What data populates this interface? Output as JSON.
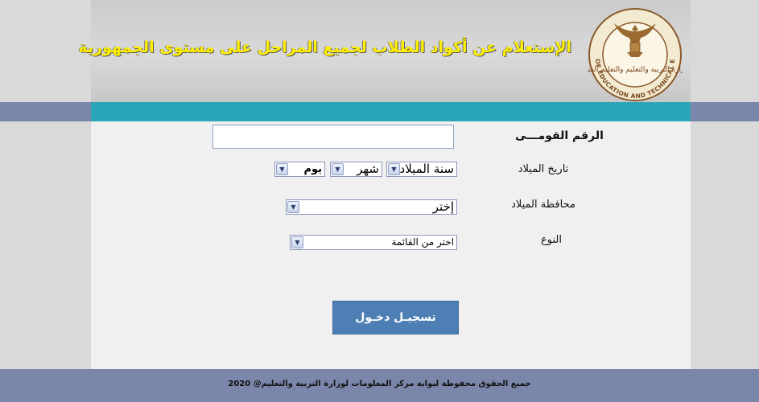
{
  "header": {
    "title": "الإستعلام عن أكواد الطلاب لجميع المراحل على مستوى الجمهورية",
    "logo": {
      "icon": "ministry-eagle-seal-icon",
      "arabic_text": "وزارة التربية والتعليم والتعليم الفني",
      "english_text": "MINISTRY OF EDUCATION AND TECHNICAL EDUCATION"
    }
  },
  "form": {
    "national_id": {
      "label": "الرقم القومـــى",
      "value": ""
    },
    "birth_date": {
      "label": "تاريخ الميلاد",
      "year": "سنة الميلاد",
      "month": "شهر",
      "day": "يوم"
    },
    "birth_governorate": {
      "label": "محافظة الميلاد",
      "value": "إختر"
    },
    "gender": {
      "label": "النوع",
      "value": "اختر من القائمة"
    },
    "submit_label": "تسجيـل دخـول"
  },
  "footer": {
    "text": "جميع الحقوق محفوظة لبوابة مركز المعلومات لوزارة التربية والتعليم@ 2020"
  },
  "colors": {
    "title_yellow": "#ffef00",
    "band_teal": "#2aa6b8",
    "band_blue_gray": "#7b87aa",
    "button_blue": "#4d7fb5"
  }
}
